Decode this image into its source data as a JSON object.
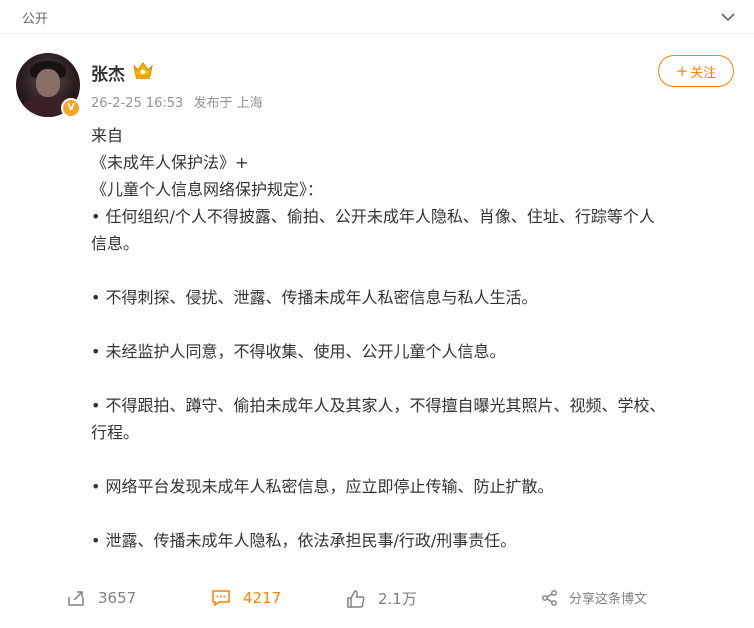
{
  "topbar": {
    "visibility": "公开"
  },
  "author": {
    "name": "张杰",
    "verified_mark": "V"
  },
  "meta": {
    "time": "26-2-25 16:53",
    "location": "发布于 上海"
  },
  "follow": {
    "label": "关注"
  },
  "content": {
    "lines": [
      "来自",
      "《未成年人保护法》+",
      "《儿童个人信息网络保护规定》：",
      "• 任何组织/个人不得披露、偷拍、公开未成年人隐私、肖像、住址、行踪等个人",
      "信息。",
      "• 不得刺探、侵扰、泄露、传播未成年人私密信息与私人生活。",
      "• 未经监护人同意，不得收集、使用、公开儿童个人信息。",
      "• 不得跟拍、蹲守、偷拍未成年人及其家人，不得擅自曝光其照片、视频、学校、",
      "行程。",
      "• 网络平台发现未成年人私密信息，应立即停止传输、防止扩散。",
      "• 泄露、传播未成年人隐私，依法承担民事/行政/刑事责任。"
    ]
  },
  "actions": {
    "reposts": "3657",
    "comments": "4217",
    "likes": "2.1万",
    "share": "分享这条博文"
  },
  "colors": {
    "accent": "#ff8200",
    "muted": "#939393",
    "text": "#333333"
  }
}
